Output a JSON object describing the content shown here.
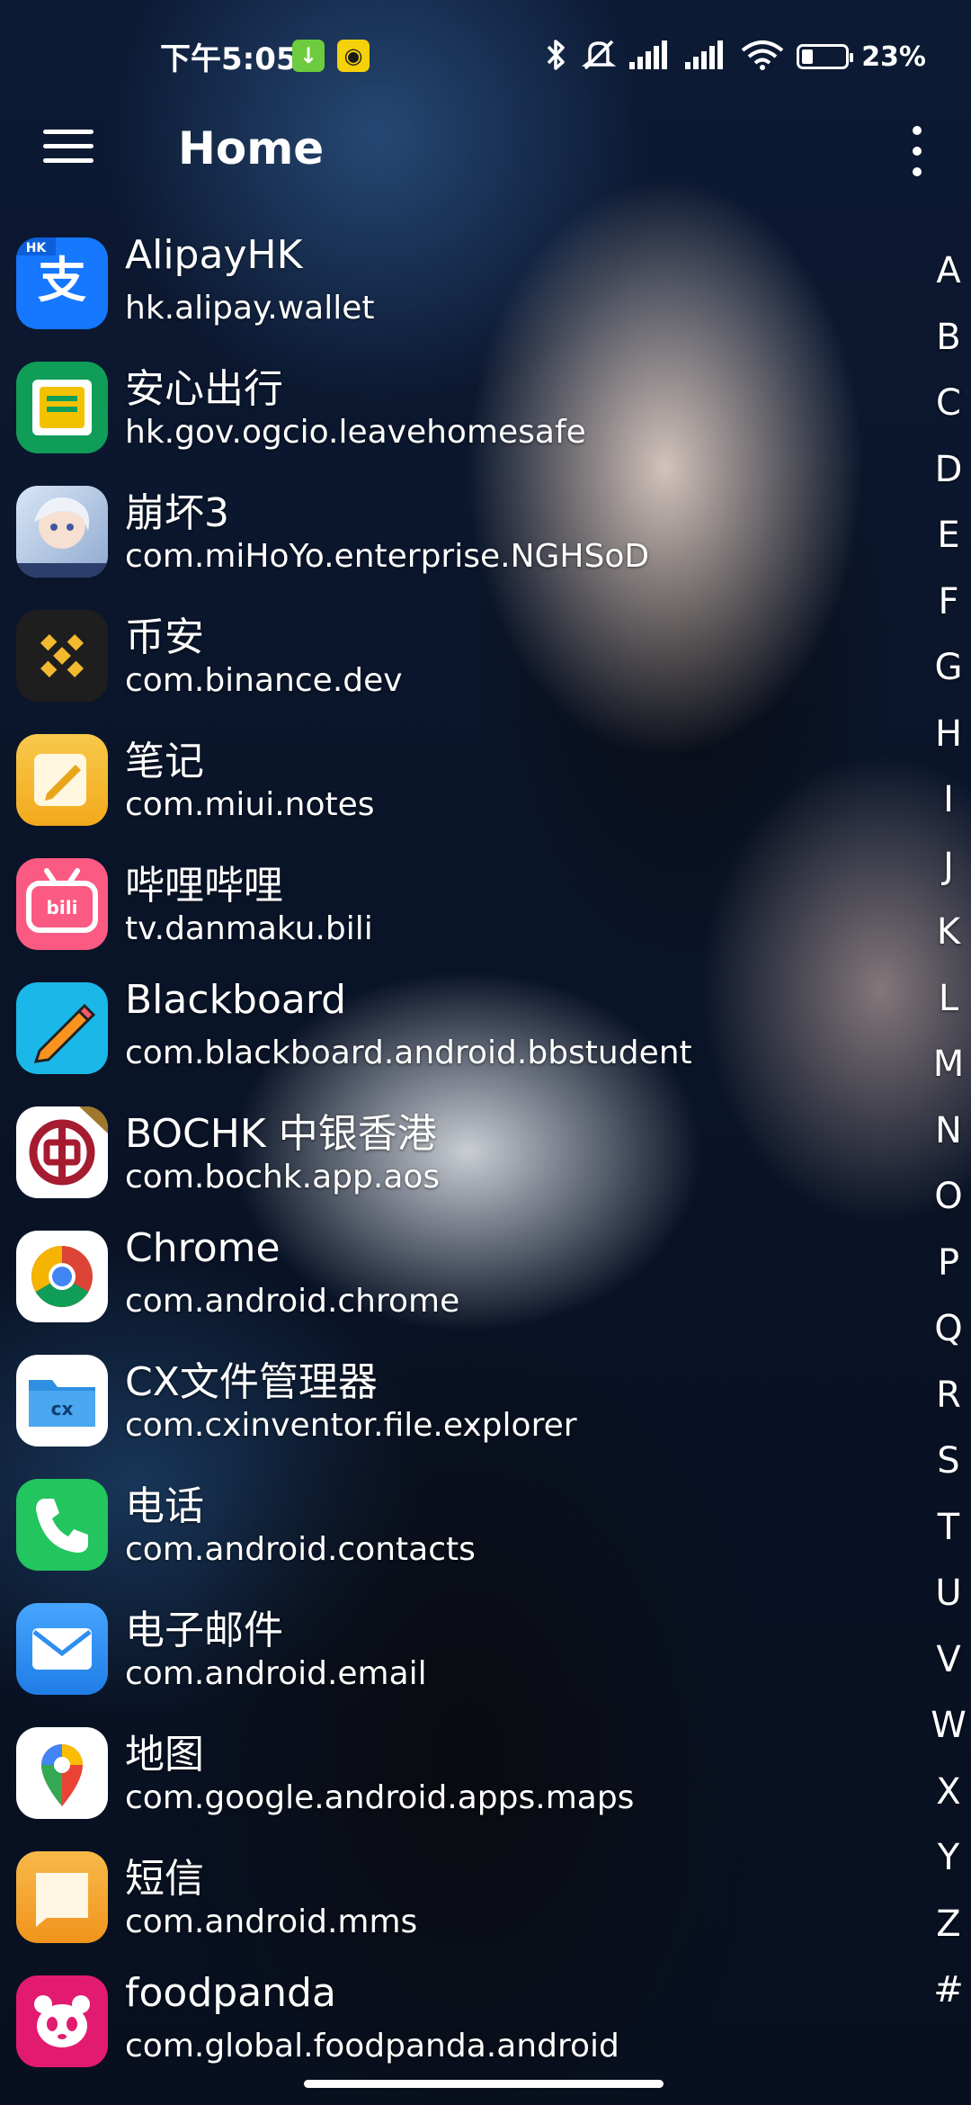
{
  "status_bar": {
    "time": "下午5:05",
    "battery_level": 0.23,
    "battery_text": "23%",
    "icons": [
      "download-notification-icon",
      "app-notification-icon",
      "bluetooth-icon",
      "mute-icon",
      "signal-icon-1",
      "signal-icon-2",
      "wifi-icon",
      "battery-icon"
    ]
  },
  "header": {
    "title": "Home",
    "menu_icon": "hamburger-menu-icon",
    "more_icon": "more-vertical-icon"
  },
  "apps": [
    {
      "name": "AlipayHK",
      "package": "hk.alipay.wallet",
      "icon": "alipayhk-icon",
      "icon_color": "#1677ff"
    },
    {
      "name": "安心出行",
      "package": "hk.gov.ogcio.leavehomesafe",
      "icon": "leavehomesafe-icon",
      "icon_color": "#0f9d58"
    },
    {
      "name": "崩坏3",
      "package": "com.miHoYo.enterprise.NGHSoD",
      "icon": "honkai3-icon",
      "icon_color": "#c9d8ec"
    },
    {
      "name": "币安",
      "package": "com.binance.dev",
      "icon": "binance-icon",
      "icon_color": "#1e1e1e"
    },
    {
      "name": "笔记",
      "package": "com.miui.notes",
      "icon": "notes-icon",
      "icon_color": "#f5b82e"
    },
    {
      "name": "哔哩哔哩",
      "package": "tv.danmaku.bili",
      "icon": "bilibili-icon",
      "icon_color": "#fb5a82"
    },
    {
      "name": "Blackboard",
      "package": "com.blackboard.android.bbstudent",
      "icon": "blackboard-icon",
      "icon_color": "#1ab8e8"
    },
    {
      "name": "BOCHK 中银香港",
      "package": "com.bochk.app.aos",
      "icon": "bochk-icon",
      "icon_color": "#a51c30"
    },
    {
      "name": "Chrome",
      "package": "com.android.chrome",
      "icon": "chrome-icon",
      "icon_color": "#ffffff"
    },
    {
      "name": "CX文件管理器",
      "package": "com.cxinventor.file.explorer",
      "icon": "cx-file-explorer-icon",
      "icon_color": "#2f8fe0"
    },
    {
      "name": "电话",
      "package": "com.android.contacts",
      "icon": "phone-icon",
      "icon_color": "#22c55e"
    },
    {
      "name": "电子邮件",
      "package": "com.android.email",
      "icon": "email-icon",
      "icon_color": "#2f8ff0"
    },
    {
      "name": "地图",
      "package": "com.google.android.apps.maps",
      "icon": "google-maps-icon",
      "icon_color": "#ffffff"
    },
    {
      "name": "短信",
      "package": "com.android.mms",
      "icon": "messages-icon",
      "icon_color": "#f5a623"
    },
    {
      "name": "foodpanda",
      "package": "com.global.foodpanda.android",
      "icon": "foodpanda-icon",
      "icon_color": "#e21b70"
    }
  ],
  "alphabet_index": [
    "A",
    "B",
    "C",
    "D",
    "E",
    "F",
    "G",
    "H",
    "I",
    "J",
    "K",
    "L",
    "M",
    "N",
    "O",
    "P",
    "Q",
    "R",
    "S",
    "T",
    "U",
    "V",
    "W",
    "X",
    "Y",
    "Z",
    "#"
  ]
}
